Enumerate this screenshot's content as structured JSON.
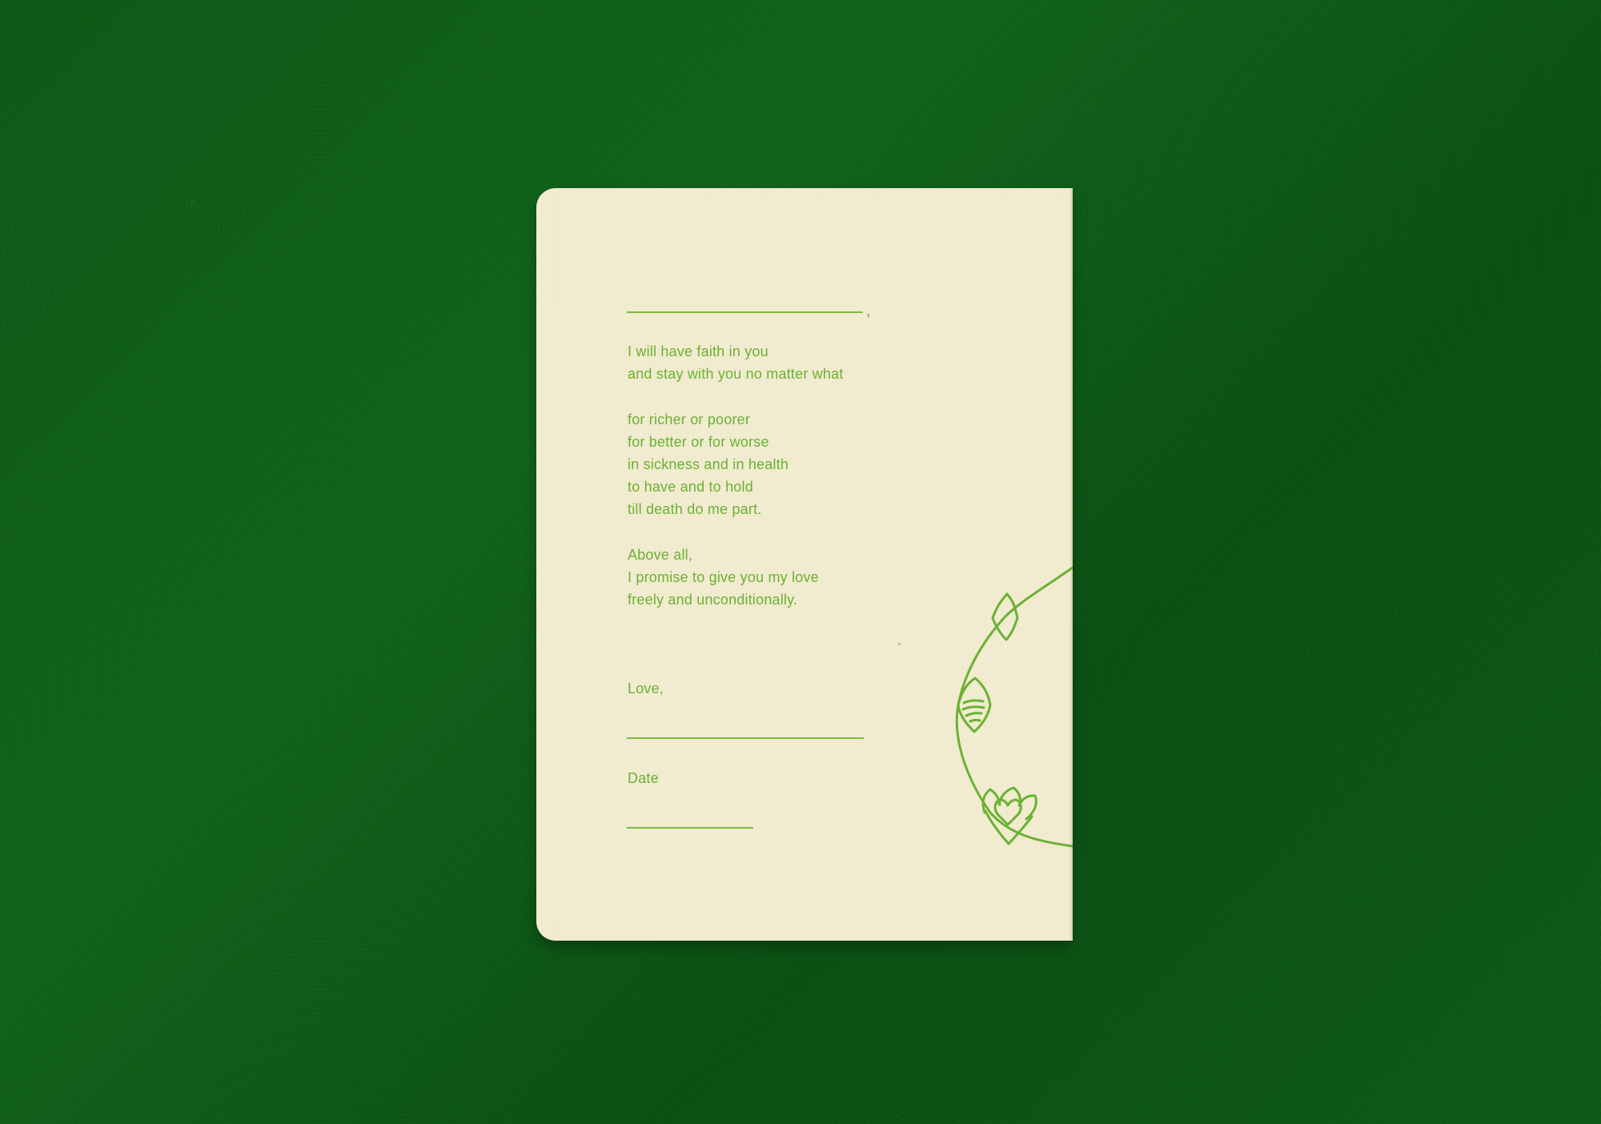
{
  "scene": {
    "colors": {
      "felt": "#0f5b18",
      "card": "#f1ebcf",
      "ink": "#6bb133"
    }
  },
  "card": {
    "stanza_1": [
      "I will have faith in you",
      "and stay with you no matter what"
    ],
    "stanza_2": [
      "for richer or poorer",
      "for better or for worse",
      "in sickness and in health",
      "to have and to hold",
      "till death do me part."
    ],
    "stanza_3": [
      "Above all,",
      "I promise to give you my love",
      "freely and unconditionally."
    ],
    "closing": "Love,",
    "date_label": "Date",
    "comma": ","
  }
}
